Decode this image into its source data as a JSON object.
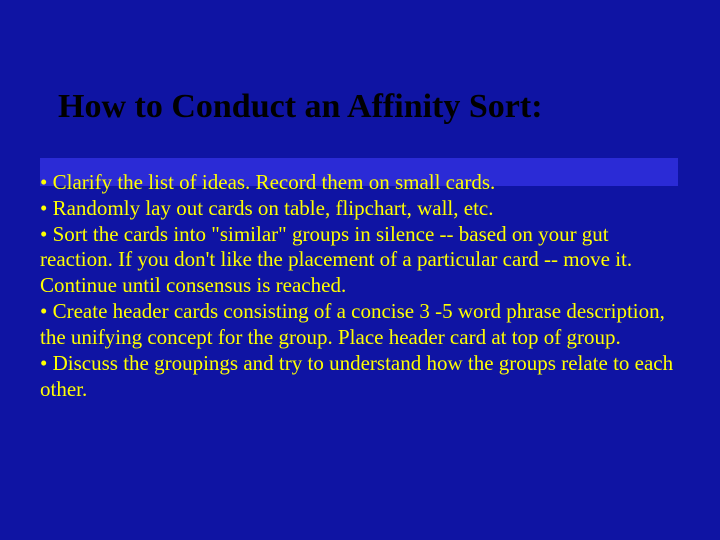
{
  "slide": {
    "title": "How to Conduct an Affinity Sort:",
    "bullets": [
      "• Clarify the list of ideas. Record them on small cards.",
      "• Randomly lay out cards on table, flipchart, wall, etc.",
      "• Sort the cards into \"similar\" groups in silence -- based on your gut reaction. If you don't like the placement of a particular card -- move it. Continue until consensus is reached.",
      "• Create header cards consisting of a concise 3 -5 word phrase description, the unifying concept for the group. Place header card at top of group.",
      "• Discuss the groupings and try to understand how the groups relate to each other."
    ]
  }
}
